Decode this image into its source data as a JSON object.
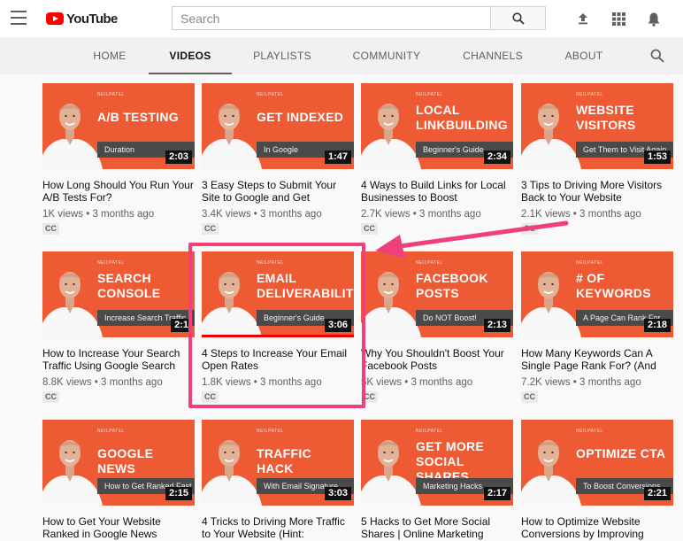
{
  "header": {
    "logo_text": "YouTube",
    "search_placeholder": "Search"
  },
  "tabs": [
    {
      "label": "HOME",
      "active": false
    },
    {
      "label": "VIDEOS",
      "active": true
    },
    {
      "label": "PLAYLISTS",
      "active": false
    },
    {
      "label": "COMMUNITY",
      "active": false
    },
    {
      "label": "CHANNELS",
      "active": false
    },
    {
      "label": "ABOUT",
      "active": false
    }
  ],
  "thumb_brand": "NEILPATEL",
  "videos": [
    {
      "thumb_title": "A/B TESTING",
      "thumb_sub": "Duration",
      "duration": "2:03",
      "title": "How Long Should You Run Your A/B Tests For?",
      "views": "1K views",
      "age": "3 months ago",
      "cc": "CC"
    },
    {
      "thumb_title": "GET INDEXED",
      "thumb_sub": "In Google",
      "duration": "1:47",
      "title": "3 Easy Steps to Submit Your Site to Google and Get",
      "views": "3.4K views",
      "age": "3 months ago",
      "cc": "CC"
    },
    {
      "thumb_title": "LOCAL LINKBUILDING",
      "thumb_sub": "Beginner's Guide",
      "duration": "2:34",
      "title": "4 Ways to Build Links for Local Businesses to Boost",
      "views": "2.7K views",
      "age": "3 months ago",
      "cc": "CC"
    },
    {
      "thumb_title": "WEBSITE VISITORS",
      "thumb_sub": "Get Them to Visit Again",
      "duration": "1:53",
      "title": "3 Tips to Driving More Visitors Back to Your Website",
      "views": "2.1K views",
      "age": "3 months ago",
      "cc": "CC"
    },
    {
      "thumb_title": "SEARCH CONSOLE",
      "thumb_sub": "Increase Search Traffic",
      "duration": "2:1",
      "title": "How to Increase Your Search Traffic Using Google Search",
      "views": "8.8K views",
      "age": "3 months ago",
      "cc": "CC"
    },
    {
      "thumb_title": "EMAIL DELIVERABILITY",
      "thumb_sub": "Beginner's Guide",
      "duration": "3:06",
      "title": "4 Steps to Increase Your Email Open Rates",
      "views": "1.8K views",
      "age": "3 months ago",
      "cc": "CC"
    },
    {
      "thumb_title": "FACEBOOK POSTS",
      "thumb_sub": "Do NOT Boost!",
      "duration": "2:13",
      "title": "Why You Shouldn't Boost Your Facebook Posts",
      "views": "5K views",
      "age": "3 months ago",
      "cc": "CC"
    },
    {
      "thumb_title": "# OF KEYWORDS",
      "thumb_sub": "A Page Can Rank For",
      "duration": "2:18",
      "title": "How Many Keywords Can A Single Page Rank For? (And",
      "views": "7.2K views",
      "age": "3 months ago",
      "cc": "CC"
    },
    {
      "thumb_title": "GOOGLE NEWS",
      "thumb_sub": "How to Get Ranked Fast",
      "duration": "2:15",
      "title": "How to Get Your Website Ranked in Google News",
      "views": "",
      "age": "",
      "cc": ""
    },
    {
      "thumb_title": "TRAFFIC HACK",
      "thumb_sub": "With Email Signature",
      "duration": "3:03",
      "title": "4 Tricks to Driving More Traffic to Your Website (Hint:",
      "views": "",
      "age": "",
      "cc": ""
    },
    {
      "thumb_title": "GET MORE SOCIAL SHARES",
      "thumb_sub": "Marketing Hacks",
      "duration": "2:17",
      "title": "5 Hacks to Get More Social Shares | Online Marketing",
      "views": "",
      "age": "",
      "cc": ""
    },
    {
      "thumb_title": "OPTIMIZE CTA",
      "thumb_sub": "To Boost Conversions",
      "duration": "2:21",
      "title": "How to Optimize Website Conversions by Improving",
      "views": "",
      "age": "",
      "cc": ""
    }
  ],
  "colors": {
    "thumb_bg": "#ee5a33",
    "highlight": "#f0407a"
  }
}
